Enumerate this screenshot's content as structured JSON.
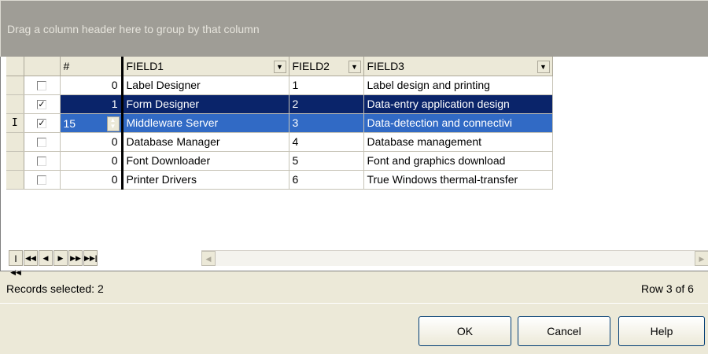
{
  "group_panel": {
    "hint": "Drag a column header here to group by that column"
  },
  "columns": [
    {
      "label": "#"
    },
    {
      "label": "FIELD1",
      "dropdown": true
    },
    {
      "label": "FIELD2",
      "dropdown": true
    },
    {
      "label": "FIELD3",
      "dropdown": true
    }
  ],
  "rows": [
    {
      "checked": false,
      "num": "0",
      "field1": "Label Designer",
      "field2": "1",
      "field3": "Label design and printing"
    },
    {
      "checked": true,
      "num": "1",
      "field1": "Form Designer",
      "field2": "2",
      "field3": "Data-entry application design"
    },
    {
      "checked": true,
      "num": "15",
      "field1": "Middleware Server",
      "field2": "3",
      "field3": "Data-detection and connectivi"
    },
    {
      "checked": false,
      "num": "0",
      "field1": "Database Manager",
      "field2": "4",
      "field3": "Database management"
    },
    {
      "checked": false,
      "num": "0",
      "field1": "Font Downloader",
      "field2": "5",
      "field3": "Font and graphics download"
    },
    {
      "checked": false,
      "num": "0",
      "field1": "Printer Drivers",
      "field2": "6",
      "field3": "True Windows thermal-transfer"
    }
  ],
  "current_row_indicator": "I",
  "status": {
    "records_selected": "Records selected: 2",
    "row_position": "Row 3 of 6"
  },
  "buttons": {
    "ok": "OK",
    "cancel": "Cancel",
    "help": "Help"
  },
  "colors": {
    "selected_row": "#0a246a",
    "current_row": "#316ac5",
    "panel": "#9f9d96",
    "window": "#ece9d8"
  }
}
